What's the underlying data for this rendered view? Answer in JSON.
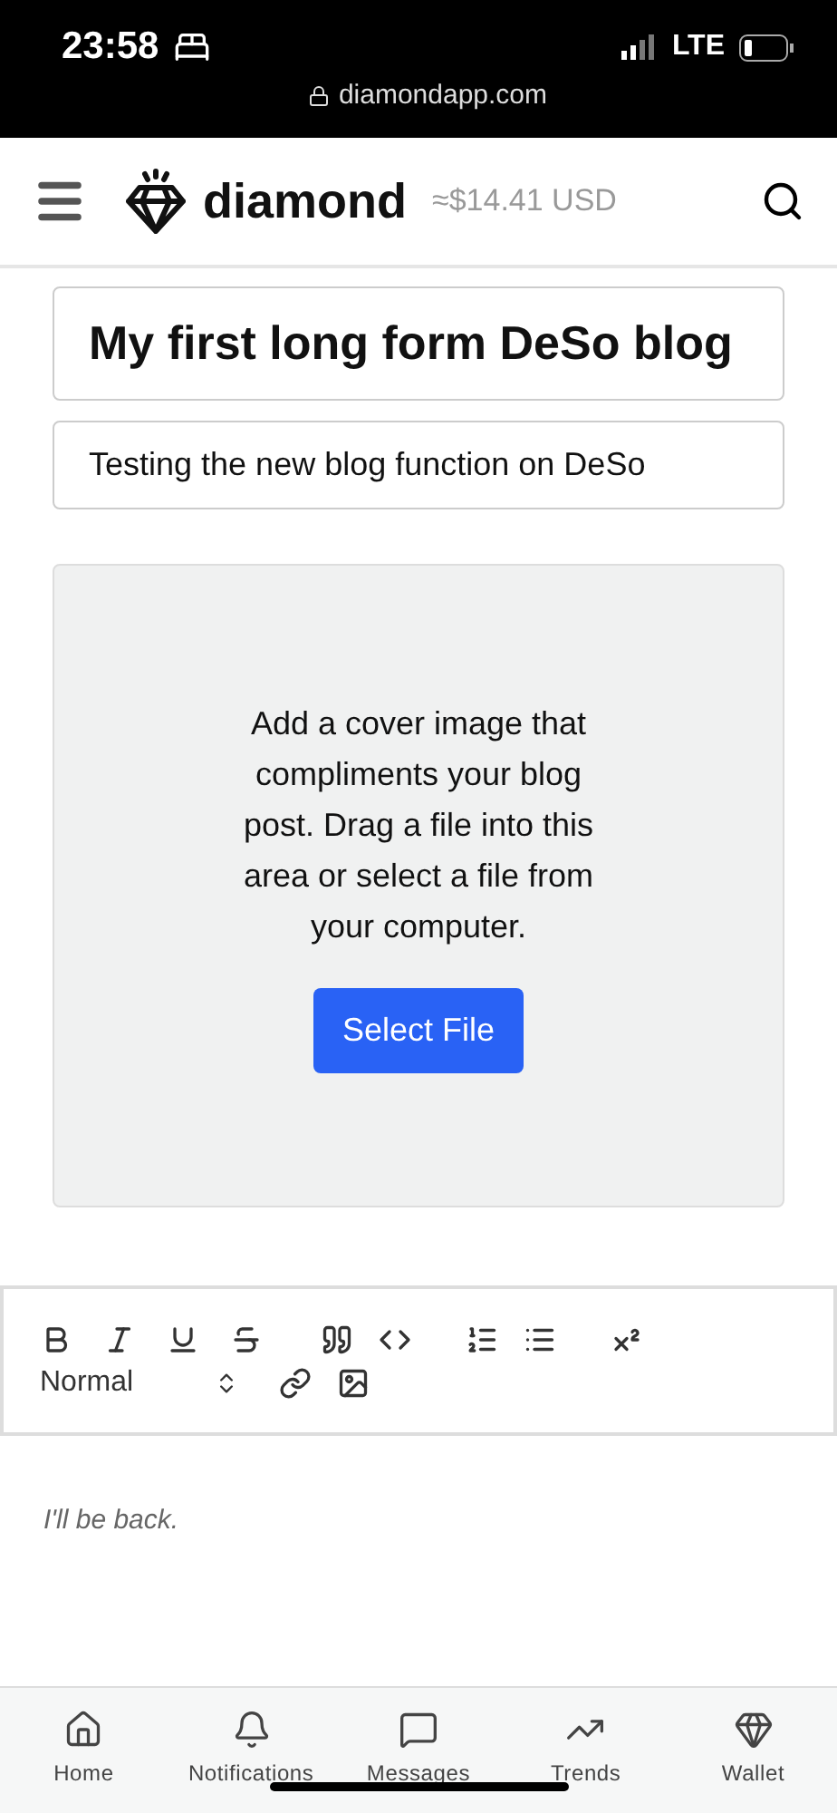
{
  "status_bar": {
    "time": "23:58",
    "network": "LTE",
    "url": "diamondapp.com"
  },
  "header": {
    "brand": "diamond",
    "balance": "≈$14.41 USD"
  },
  "title_field": {
    "value": "My first long form DeSo blog"
  },
  "subtitle_field": {
    "value": "Testing the new blog function on DeSo"
  },
  "cover": {
    "prompt": "Add a cover image that compliments your blog post. Drag a file into this area or select a file from your computer.",
    "button": "Select File"
  },
  "editor": {
    "format": "Normal",
    "body": "I'll be back."
  },
  "nav": [
    {
      "kind": "home",
      "label": "Home"
    },
    {
      "kind": "bell",
      "label": "Notifications"
    },
    {
      "kind": "message",
      "label": "Messages"
    },
    {
      "kind": "trend",
      "label": "Trends"
    },
    {
      "kind": "gem",
      "label": "Wallet"
    }
  ]
}
